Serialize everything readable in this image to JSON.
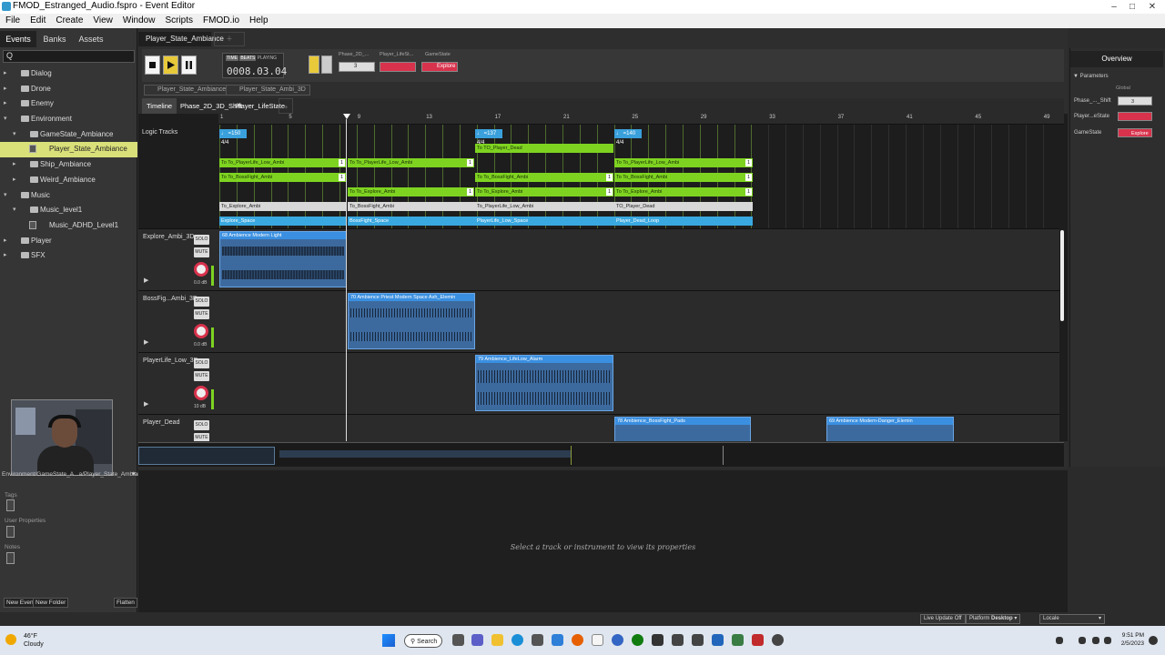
{
  "window": {
    "title": "FMOD_Estranged_Audio.fspro - Event Editor"
  },
  "menu": [
    "File",
    "Edit",
    "Create",
    "View",
    "Window",
    "Scripts",
    "FMOD.io",
    "Help"
  ],
  "browser": {
    "tabs": [
      "Events",
      "Banks",
      "Assets"
    ],
    "search_icon": "Q",
    "tree": [
      {
        "label": "Dialog",
        "depth": 0,
        "type": "folder"
      },
      {
        "label": "Drone",
        "depth": 0,
        "type": "folder"
      },
      {
        "label": "Enemy",
        "depth": 0,
        "type": "folder"
      },
      {
        "label": "Environment",
        "depth": 0,
        "type": "folder",
        "open": true
      },
      {
        "label": "GameState_Ambiance",
        "depth": 1,
        "type": "folder",
        "open": true
      },
      {
        "label": "Player_State_Ambiance",
        "depth": 2,
        "type": "event",
        "selected": true
      },
      {
        "label": "Ship_Ambiance",
        "depth": 1,
        "type": "folder"
      },
      {
        "label": "Weird_Ambiance",
        "depth": 1,
        "type": "folder"
      },
      {
        "label": "Music",
        "depth": 0,
        "type": "folder",
        "open": true
      },
      {
        "label": "Music_level1",
        "depth": 1,
        "type": "folder",
        "open": true
      },
      {
        "label": "Music_ADHD_Level1",
        "depth": 2,
        "type": "event"
      },
      {
        "label": "Player",
        "depth": 0,
        "type": "folder"
      },
      {
        "label": "SFX",
        "depth": 0,
        "type": "folder"
      }
    ],
    "path": "Environment/GameState_A...a/Player_State_Ambiance",
    "sections": [
      "Tags",
      "User Properties",
      "Notes"
    ],
    "buttons": [
      "New Event",
      "New Folder",
      "Flatten"
    ]
  },
  "editor": {
    "event_tab": "Player_State_Ambiance",
    "transport": {
      "modes": [
        "TIME",
        "BEATS"
      ],
      "state": "PLAYING",
      "time": "0008.03.04"
    },
    "params": [
      {
        "label": "Phase_2D_...",
        "value": "3",
        "color": "#dddddd"
      },
      {
        "label": "Player_LifeSt...",
        "value": "",
        "color": "#d8324c"
      },
      {
        "label": "GameState",
        "value": "Explore",
        "color": "#d8324c"
      }
    ],
    "breadcrumbs": [
      "Player_State_Ambiance",
      "Player_State_Ambi_3D"
    ],
    "subtabs": [
      "Timeline",
      "Phase_2D_3D_Shift",
      "Player_LifeState"
    ],
    "ruler": [
      "1",
      "5",
      "9",
      "13",
      "17",
      "21",
      "25",
      "29",
      "33",
      "37",
      "41",
      "45",
      "49"
    ],
    "logic_label": "Logic Tracks",
    "tempo": [
      "♩ =150 4/4",
      "♩ =137 4/4",
      "♩ =140 4/4"
    ],
    "logic_rows": {
      "dead": "To TO_Player_Dead",
      "life": [
        "To To_PlayerLife_Low_Ambi",
        "To To_PlayerLife_Low_Ambi",
        "To To_PlayerLife_Low_Ambi"
      ],
      "boss": [
        "To To_BossFight_Ambi",
        "To To_BossFight_Ambi",
        "To To_BossFight_Ambi"
      ],
      "explore": [
        "To To_Explore_Ambi",
        "To To_Explore_Ambi",
        "To To_Explore_Ambi"
      ],
      "dest": [
        "To_Explore_Ambi",
        "To_BossFight_Ambi",
        "To_PlayerLife_Low_Ambi",
        "TO_Player_Dead"
      ],
      "regions": [
        "Explore_Space",
        "BossFight_Space",
        "PlayerLife_Low_Space",
        "Player_Dead_Loop"
      ]
    },
    "tracks": [
      {
        "name": "Explore_Ambi_3D",
        "db": "0.0 dB",
        "inst": "68 Ambience Modern Light"
      },
      {
        "name": "BossFig...Ambi_3D",
        "db": "0.0 dB",
        "inst": "70 Ambience Priest Modern Space Ash_Elemin"
      },
      {
        "name": "PlayerLife_Low_3D",
        "db": "10 dB",
        "inst": "79 Ambience_LifeLow_Alarm"
      },
      {
        "name": "Player_Dead",
        "db": "",
        "inst": "78 Ambience_BossFight_Pads",
        "inst2": "69 Ambience Modern-Danger_Elemin"
      }
    ],
    "solo": "SOLO",
    "mute": "MUTE"
  },
  "properties": {
    "placeholder": "Select a track or instrument to view its properties"
  },
  "overview": {
    "title": "Overview",
    "section": "Parameters",
    "group": "Global",
    "params": [
      {
        "label": "Phase_..._Shift",
        "value": "3",
        "color": "#dddddd"
      },
      {
        "label": "Player...eState",
        "value": "",
        "color": "#d8324c"
      },
      {
        "label": "GameState",
        "value": "Explore",
        "color": "#d8324c"
      }
    ]
  },
  "statusbar": {
    "live_update": "Live Update Off",
    "platform_label": "Platform",
    "platform": "Desktop",
    "locale": "Locale"
  },
  "taskbar": {
    "temp": "46°F",
    "weather": "Cloudy",
    "search": "Search",
    "time": "9:51 PM",
    "date": "2/5/2023"
  }
}
